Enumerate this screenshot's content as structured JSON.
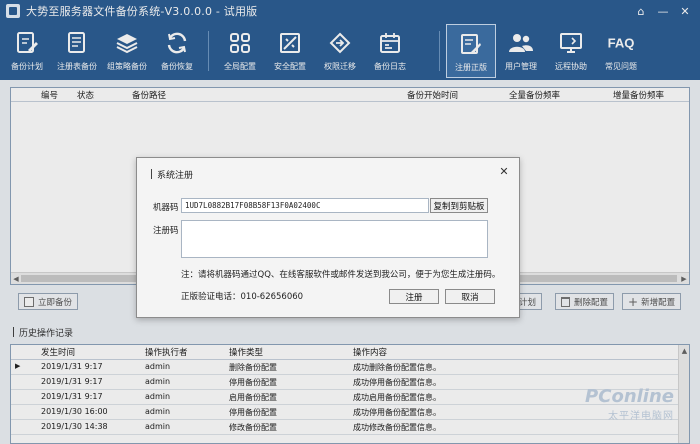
{
  "window": {
    "title": "大势至服务器文件备份系统-V3.0.0.0 - 试用版",
    "controls": [
      "⌂",
      "—",
      "✕"
    ]
  },
  "toolbar": {
    "items": [
      {
        "label": "备份计划",
        "icon": "edit-doc-icon"
      },
      {
        "label": "注册表备份",
        "icon": "registry-doc-icon"
      },
      {
        "label": "组策略备份",
        "icon": "layers-icon"
      },
      {
        "label": "备份恢复",
        "icon": "refresh-icon"
      },
      {
        "label": "全局配置",
        "icon": "grid-icon"
      },
      {
        "label": "安全配置",
        "icon": "security-icon"
      },
      {
        "label": "权限迁移",
        "icon": "migrate-icon"
      },
      {
        "label": "备份日志",
        "icon": "calendar-icon"
      },
      {
        "label": "注册正版",
        "icon": "register-icon"
      },
      {
        "label": "用户管理",
        "icon": "users-icon"
      },
      {
        "label": "远程协助",
        "icon": "monitor-icon"
      },
      {
        "label": "常见问题",
        "icon": "faq-icon"
      }
    ]
  },
  "backup_table": {
    "columns": [
      "编号",
      "状态",
      "备份路径",
      "备份开始时间",
      "全量备份频率",
      "增量备份频率"
    ]
  },
  "actions": {
    "start_backup": "立即备份",
    "edit_plan": "计划",
    "delete_config": "删除配置",
    "add_config": "新增配置"
  },
  "history": {
    "title": "历史操作记录",
    "columns": [
      "发生时间",
      "操作执行者",
      "操作类型",
      "操作内容"
    ],
    "rows": [
      {
        "time": "2019/1/31  9:17",
        "user": "admin",
        "type": "删除备份配置",
        "content": "成功删除备份配置信息。"
      },
      {
        "time": "2019/1/31  9:17",
        "user": "admin",
        "type": "停用备份配置",
        "content": "成功停用备份配置信息。"
      },
      {
        "time": "2019/1/31  9:17",
        "user": "admin",
        "type": "启用备份配置",
        "content": "成功启用备份配置信息。"
      },
      {
        "time": "2019/1/30  16:00",
        "user": "admin",
        "type": "停用备份配置",
        "content": "成功停用备份配置信息。"
      },
      {
        "time": "2019/1/30  14:38",
        "user": "admin",
        "type": "修改备份配置",
        "content": "成功修改备份配置信息。"
      }
    ]
  },
  "dialog": {
    "title": "系统注册",
    "machine_label": "机器码",
    "machine_code": "1UD7L0882B17F08B58F13F0A02400C",
    "copy_button": "复制到剪贴板",
    "reg_label": "注册码",
    "reg_value": "",
    "note": "注：请将机器码通过QQ、在线客服软件或邮件发送到我公司，便于为您生成注册码。",
    "phone": "正版验证电话：010-62656060",
    "register_button": "注册",
    "cancel_button": "取消"
  },
  "watermark": {
    "brand": "PConline",
    "sub": "太平洋电脑网"
  }
}
